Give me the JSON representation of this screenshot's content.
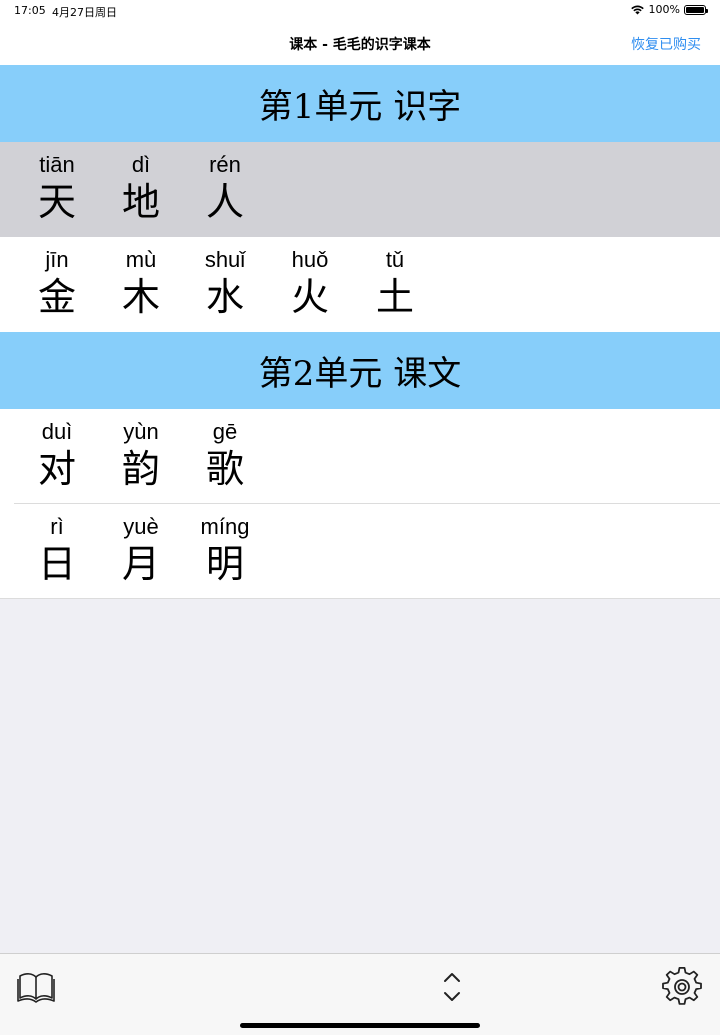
{
  "status_bar": {
    "time": "17:05",
    "date": "4月27日周日",
    "battery": "100%"
  },
  "nav": {
    "title": "课本 - 毛毛的识字课本",
    "restore_label": "恢复已购买"
  },
  "colors": {
    "unit_header": "#87cefa",
    "selected_row": "#d1d1d6",
    "accent": "#2f8ef0",
    "background": "#efeff4"
  },
  "units": [
    {
      "title": "第1单元 识字",
      "lessons": [
        {
          "selected": true,
          "chars": [
            {
              "pinyin": "tiān",
              "hanzi": "天"
            },
            {
              "pinyin": "dì",
              "hanzi": "地"
            },
            {
              "pinyin": "rén",
              "hanzi": "人"
            }
          ]
        },
        {
          "selected": false,
          "chars": [
            {
              "pinyin": "jīn",
              "hanzi": "金"
            },
            {
              "pinyin": "mù",
              "hanzi": "木"
            },
            {
              "pinyin": "shuǐ",
              "hanzi": "水"
            },
            {
              "pinyin": "huǒ",
              "hanzi": "火"
            },
            {
              "pinyin": "tǔ",
              "hanzi": "土"
            }
          ]
        }
      ]
    },
    {
      "title": "第2单元 课文",
      "lessons": [
        {
          "selected": false,
          "chars": [
            {
              "pinyin": "duì",
              "hanzi": "对"
            },
            {
              "pinyin": "yùn",
              "hanzi": "韵"
            },
            {
              "pinyin": "gē",
              "hanzi": "歌"
            }
          ]
        },
        {
          "selected": false,
          "chars": [
            {
              "pinyin": "rì",
              "hanzi": "日"
            },
            {
              "pinyin": "yuè",
              "hanzi": "月"
            },
            {
              "pinyin": "míng",
              "hanzi": "明"
            }
          ]
        }
      ]
    }
  ],
  "tab_bar": {
    "left_icon": "book-icon",
    "center_icon": "chevron-up-down-icon",
    "right_icon": "gear-icon"
  }
}
